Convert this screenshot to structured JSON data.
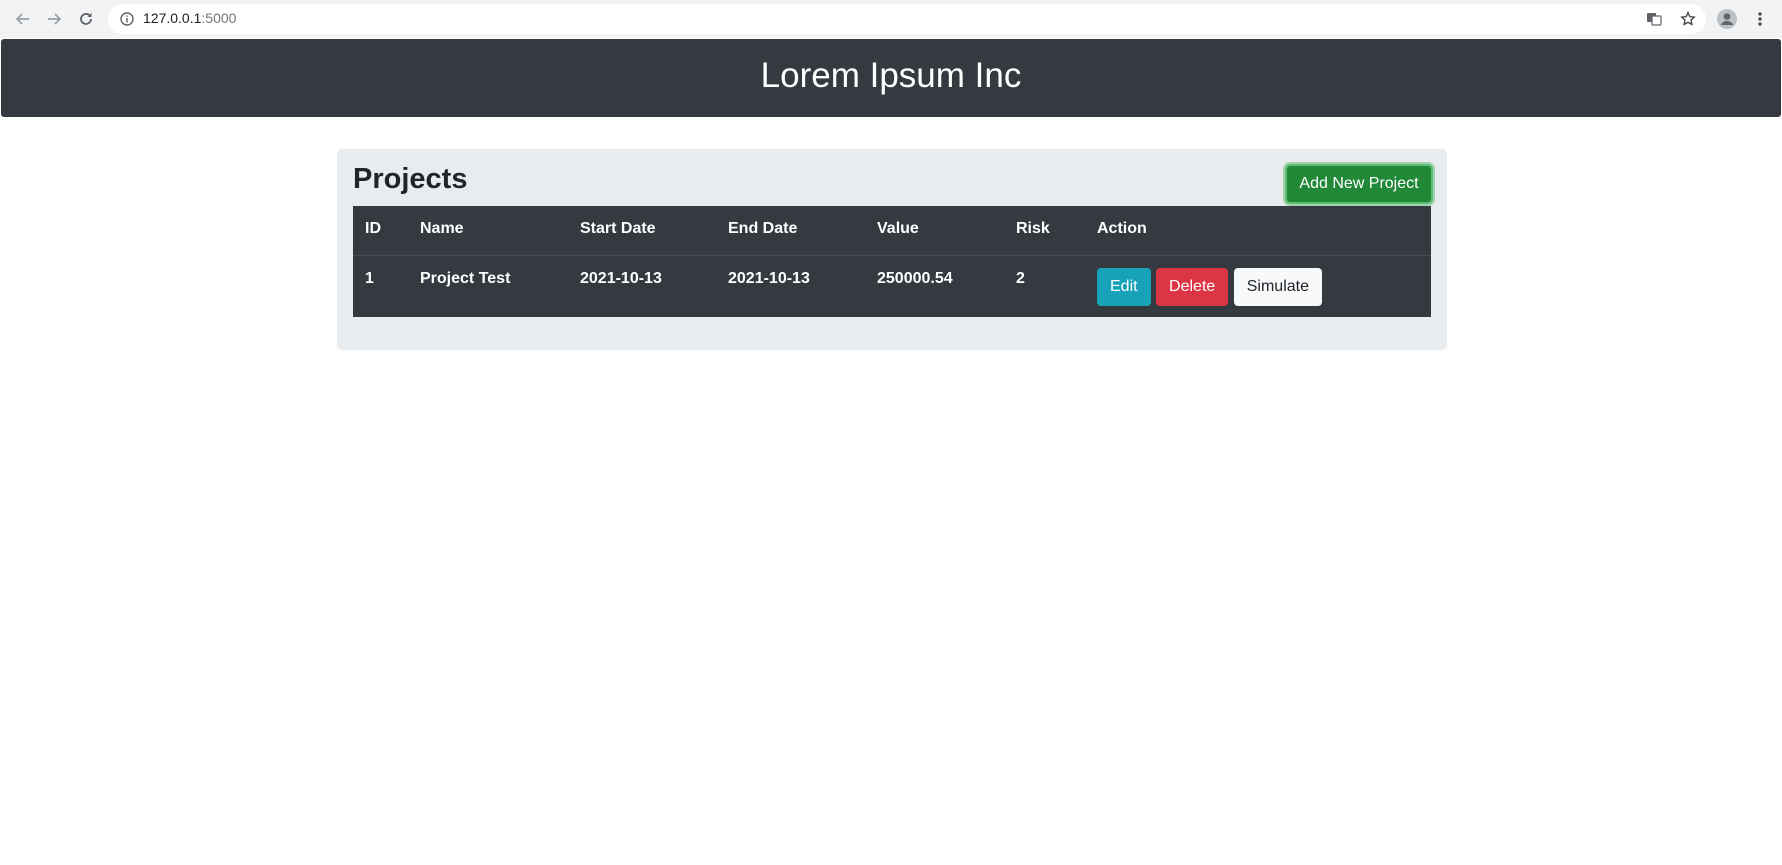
{
  "browser": {
    "url_host": "127.0.0.1",
    "url_port": ":5000"
  },
  "header": {
    "title": "Lorem Ipsum Inc"
  },
  "projects": {
    "title": "Projects",
    "add_button_label": "Add New Project",
    "columns": [
      "ID",
      "Name",
      "Start Date",
      "End Date",
      "Value",
      "Risk",
      "Action"
    ],
    "rows": [
      {
        "id": "1",
        "name": "Project Test",
        "start_date": "2021-10-13",
        "end_date": "2021-10-13",
        "value": "250000.54",
        "risk": "2",
        "actions": {
          "edit": "Edit",
          "delete": "Delete",
          "simulate": "Simulate"
        }
      }
    ]
  },
  "colors": {
    "header_bg": "#343a40",
    "card_bg": "#e9ecef",
    "success": "#218838",
    "info": "#17a2b8",
    "danger": "#dc3545",
    "light": "#f8f9fa"
  }
}
